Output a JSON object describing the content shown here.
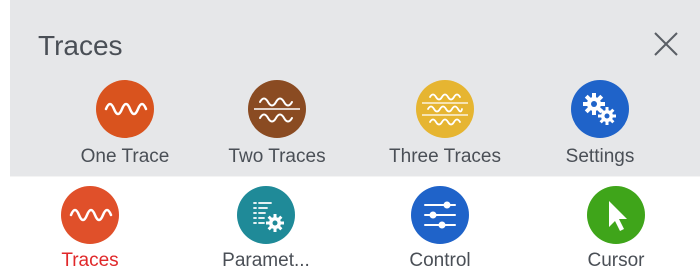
{
  "panel": {
    "title": "Traces",
    "items": [
      {
        "label": "One Trace",
        "icon": "one-trace-icon",
        "color": "#d9531e"
      },
      {
        "label": "Two Traces",
        "icon": "two-traces-icon",
        "color": "#8a4b22"
      },
      {
        "label": "Three Traces",
        "icon": "three-traces-icon",
        "color": "#e6b531"
      },
      {
        "label": "Settings",
        "icon": "settings-gears-icon",
        "color": "#1f63c9"
      }
    ]
  },
  "bottom_nav": {
    "active_color": "#e0282a",
    "items": [
      {
        "label": "Traces",
        "icon": "traces-wave-icon",
        "color": "#e0502a",
        "active": true
      },
      {
        "label": "Paramet...",
        "icon": "parameters-icon",
        "color": "#1f8a98",
        "active": false
      },
      {
        "label": "Control",
        "icon": "control-sliders-icon",
        "color": "#1f63c9",
        "active": false
      },
      {
        "label": "Cursor",
        "icon": "cursor-arrow-icon",
        "color": "#3fa51a",
        "active": false
      }
    ]
  }
}
